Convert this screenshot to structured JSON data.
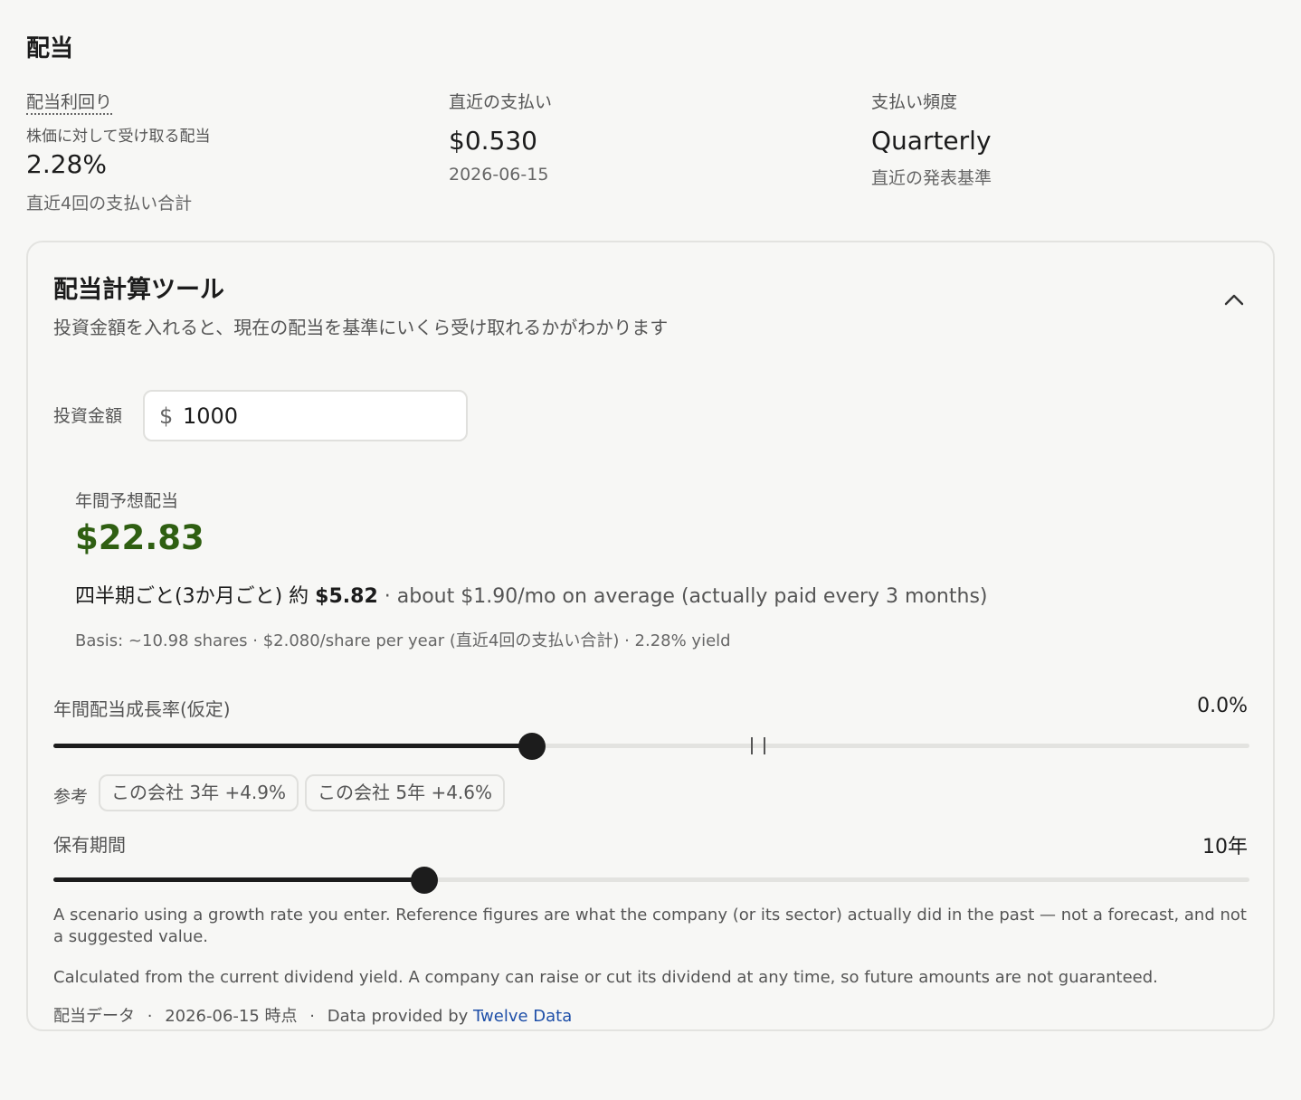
{
  "section_title": "配当",
  "stats": {
    "yield": {
      "label": "配当利回り",
      "sublabel": "株価に対して受け取る配当",
      "value": "2.28%",
      "note": "直近4回の支払い合計"
    },
    "latest_payment": {
      "label": "直近の支払い",
      "value": "$0.530",
      "note": "2026-06-15"
    },
    "frequency": {
      "label": "支払い頻度",
      "value": "Quarterly",
      "note": "直近の発表基準"
    }
  },
  "calculator": {
    "title": "配当計算ツール",
    "description": "投資金額を入れると、現在の配当を基準にいくら受け取れるかがわかります",
    "collapse_icon": "chevron-up-icon",
    "amount_label": "投資金額",
    "currency_symbol": "$",
    "amount_value": "1000",
    "annual_label": "年間予想配当",
    "annual_value": "$22.83",
    "quarterly_prefix": "四半期ごと(3か月ごと) 約",
    "quarterly_value": "$5.82",
    "quarterly_suffix": " · about $1.90/mo on average (actually paid every 3 months)",
    "basis": "Basis: ~10.98 shares · $2.080/share per year (直近4回の支払い合計) · 2.28% yield",
    "growth": {
      "label": "年間配当成長率(仮定)",
      "value_text": "0.0%",
      "slider_fraction": 0.4
    },
    "reference": {
      "label": "参考",
      "chips": [
        "この会社 3年 +4.9%",
        "この会社 5年 +4.6%"
      ]
    },
    "holding": {
      "label": "保有期間",
      "value_text": "10年",
      "slider_fraction": 0.31
    },
    "note_scenario": "A scenario using a growth rate you enter. Reference figures are what the company (or its sector) actually did in the past — not a forecast, and not a suggested value.",
    "note_yield": "Calculated from the current dividend yield. A company can raise or cut its dividend at any time, so future amounts are not guaranteed.",
    "footer": {
      "source": "配当データ",
      "sep1": "·",
      "as_of": "2026-06-15 時点",
      "sep2": "·",
      "provided_by": "Data provided by",
      "provider_link": "Twelve Data"
    }
  },
  "colors": {
    "background": "#f7f7f5",
    "accent_green": "#2f5f12",
    "link_blue": "#1e4fa8",
    "slider_fill": "#1c1c1c",
    "slider_track": "#e3e3e0"
  }
}
